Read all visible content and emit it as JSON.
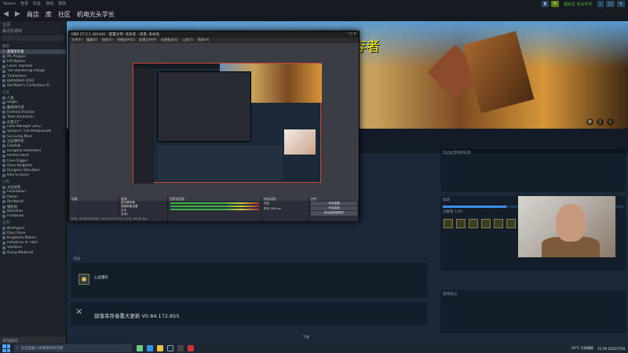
{
  "steam": {
    "top_menu": [
      "Steam",
      "查看",
      "好友",
      "游戏",
      "帮助"
    ],
    "top_right": {
      "notice_label": "",
      "user_label": "杨先生 光头学长"
    },
    "nav": {
      "store": "商店",
      "library": "库",
      "community": "社区",
      "profile": "机电光头学长"
    }
  },
  "sidebar": {
    "home_label": "主页",
    "filter_label": "最近的游戏",
    "categories": {
      "recent": "最近",
      "july": "七月",
      "june": "六月",
      "may": "五月"
    },
    "recent_items": [
      {
        "label": "部落幸存者"
      },
      {
        "label": "Mr. Prepper"
      },
      {
        "label": "InfraSpace"
      },
      {
        "label": "Cities: Skylines"
      },
      {
        "label": "The Wandering Village"
      },
      {
        "label": "Timberborn"
      },
      {
        "label": "Battlefield 2042"
      },
      {
        "label": "Sid Meier's Civilization VI"
      }
    ],
    "july_items": [
      {
        "label": "人类"
      },
      {
        "label": "Dagon"
      },
      {
        "label": "戴森球计划"
      },
      {
        "label": "Farthest Frontier"
      },
      {
        "label": "Town Ascension"
      },
      {
        "label": "异星工厂"
      },
      {
        "label": "Farm Manager 2022"
      },
      {
        "label": "Vampire: The Masquerade"
      },
      {
        "label": "Surviving Mars"
      },
      {
        "label": "沙石镇时光"
      },
      {
        "label": "Clanfolk"
      },
      {
        "label": "Dungeon Defenders"
      },
      {
        "label": "Perfect Heist"
      },
      {
        "label": "Cave Digger"
      },
      {
        "label": "Oasis Kingdom"
      },
      {
        "label": "Dungeon Simulator"
      },
      {
        "label": "Rise to Ruins"
      }
    ],
    "june_items": [
      {
        "label": "太吾绘卷"
      },
      {
        "label": "Foundation"
      },
      {
        "label": "Patron"
      },
      {
        "label": "RimWorld"
      },
      {
        "label": "殖民地"
      },
      {
        "label": "Banished"
      },
      {
        "label": "Frostpunk"
      }
    ],
    "may_items": [
      {
        "label": "Northgard"
      },
      {
        "label": "Days Gone"
      },
      {
        "label": "Kingdoms Reborn"
      },
      {
        "label": "Industries of Titan"
      },
      {
        "label": "Stardeus"
      },
      {
        "label": "Going Medieval"
      }
    ],
    "add_game": "添加游戏"
  },
  "hero": {
    "title": "游戏名：部落幸存者"
  },
  "main": {
    "news_title": "最近动态",
    "update_title": "部落幸存者重大更新 V0.84.172.655",
    "achievement_title": "心态爆炸",
    "friends_title": "玩过此游戏的好友",
    "achievements_title": "成就",
    "achievements_progress": "已解锁 1/56",
    "notes_title": "游戏笔记",
    "activity_label": "活动",
    "download_label": "下载"
  },
  "obs": {
    "title": "OBS 27.2.1 (64-bit) - 配置文件: 未命名 - 场景: 未命名",
    "menu": [
      "文件(F)",
      "编辑(E)",
      "视图(V)",
      "停靠部件(D)",
      "配置文件(P)",
      "场景集合(S)",
      "工具(T)",
      "帮助(H)"
    ],
    "docks": {
      "scenes": "场景",
      "sources": "来源",
      "mixer": "音频混音器",
      "transitions": "转场动画",
      "controls": "控件"
    },
    "sources": [
      "显示器采集",
      "视频采集设备",
      "文本",
      "文本2"
    ],
    "controls": [
      "开始直播",
      "开始录制",
      "启动虚拟摄像机",
      "工作室模式",
      "设置",
      "退出"
    ],
    "transition_fade": "淡出",
    "duration_label": "时长",
    "duration_value": "300 ms",
    "status": "LIVE: 00:00:00  REC: 00:11:07  CPU: 2.1%, 60.00 fps"
  },
  "taskbar": {
    "search_placeholder": "在这里输入你要搜索的内容",
    "weather": "26°C 大部晴朗",
    "time": "21:59",
    "date": "2022/7/18"
  },
  "colors": {
    "steam_bg": "#1b2838",
    "steam_nav": "#171a21",
    "hero_title": "#fff500",
    "obs_bg": "#282b33"
  }
}
